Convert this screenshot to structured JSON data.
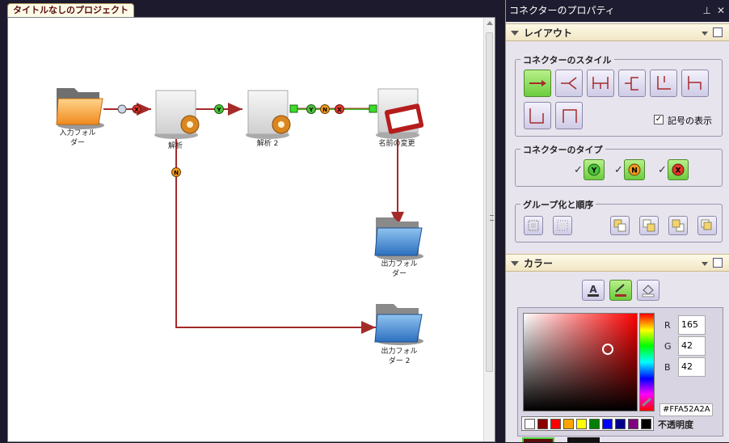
{
  "document": {
    "tab_title": "タイトルなしのプロジェクト"
  },
  "diagram": {
    "nodes": {
      "input_folder": "入力フォル\nダー",
      "parse_1": "解析",
      "parse_2": "解析 2",
      "rename": "名前の変更",
      "output_folder": "出力フォル\nダー",
      "output_folder_2": "出力フォル\nダー 2"
    },
    "connector_markers": {
      "yes": "Y",
      "no": "N",
      "exception": "X"
    },
    "colors": {
      "connector": "#A52A2A",
      "selected_connector": "#3CBF1E",
      "yes_marker": "#4CC13A",
      "no_marker": "#F39B1B",
      "exception_marker": "#E23A2A"
    }
  },
  "panel": {
    "title": "コネクターのプロパティ",
    "pin_icon": "pin-icon",
    "close_icon": "close-icon",
    "layout_section": {
      "title": "レイアウト",
      "connector_style_group": "コネクターのスタイル",
      "show_symbols_label": "記号の表示",
      "show_symbols_checked": true,
      "connector_type_group": "コネクターのタイプ",
      "grouping_group": "グループ化と順序"
    },
    "color_section": {
      "title": "カラー",
      "r_label": "R",
      "g_label": "G",
      "b_label": "B",
      "r_value": "165",
      "g_value": "42",
      "b_value": "42",
      "hex_value": "#FFA52A2A",
      "opacity_label": "不透明度",
      "swatches": [
        "#ffffff",
        "#8b0000",
        "#ff0000",
        "#ffa500",
        "#ffff00",
        "#008000",
        "#0000ff",
        "#00008b",
        "#800080",
        "#000000"
      ]
    }
  }
}
